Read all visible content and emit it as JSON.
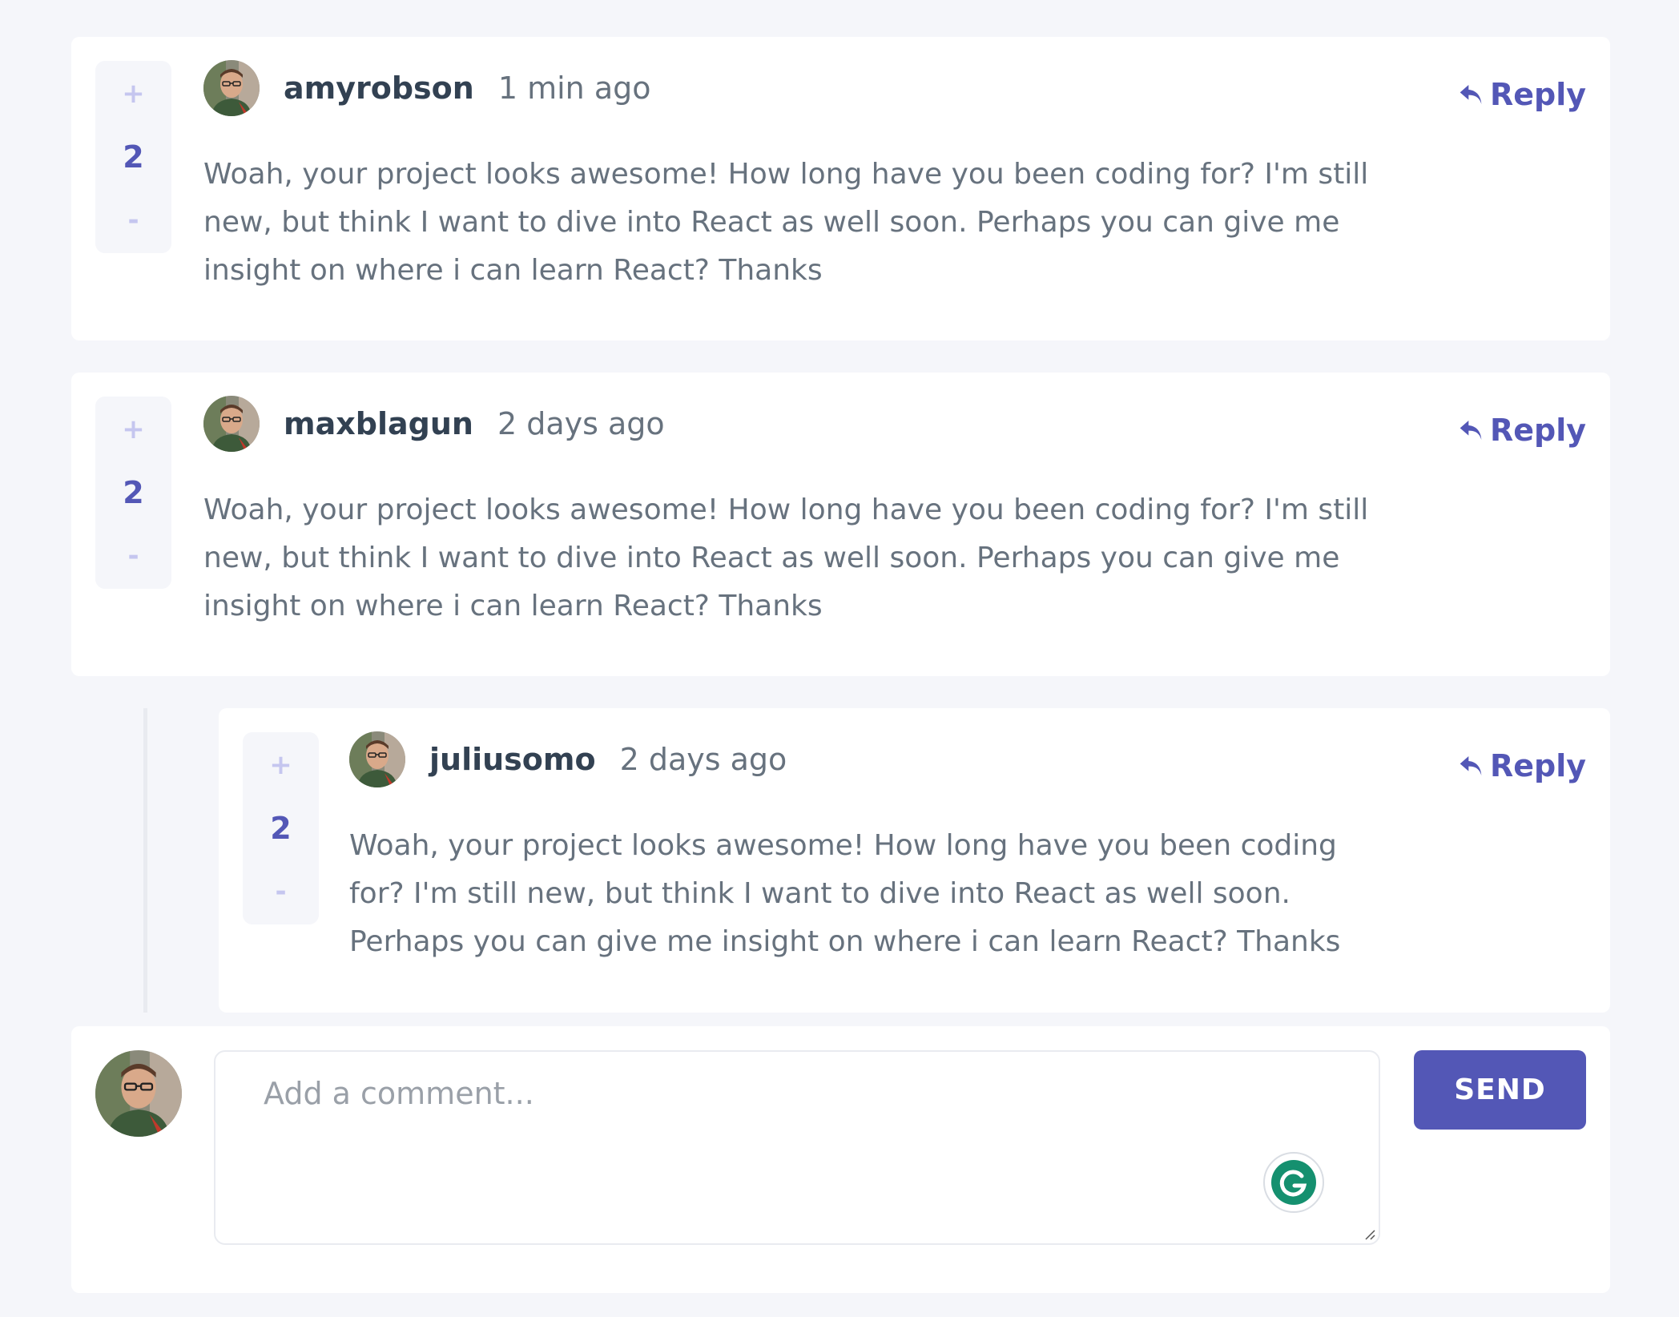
{
  "colors": {
    "background": "#f5f6fa",
    "card": "#ffffff",
    "accent": "#5357b6",
    "accent_light": "#c5c6ef",
    "text_dark": "#324152",
    "text_muted": "#67727e"
  },
  "comments": [
    {
      "username": "amyrobson",
      "time": "1 min ago",
      "score": "2",
      "upvote": "+",
      "downvote": "-",
      "reply_label": "Reply",
      "content": "Woah, your project looks awesome! How long have you been coding for? I'm still new, but think I want to dive into React as well soon. Perhaps you can give me insight on where i can learn React? Thanks",
      "avatar_icon": "user-avatar-icon"
    },
    {
      "username": "maxblagun",
      "time": "2 days ago",
      "score": "2",
      "upvote": "+",
      "downvote": "-",
      "reply_label": "Reply",
      "content": "Woah, your project looks awesome! How long have you been coding for? I'm still new, but think I want to dive into React as well soon. Perhaps you can give me insight on where i can learn React? Thanks",
      "avatar_icon": "user-avatar-icon"
    }
  ],
  "replies": [
    {
      "username": "juliusomo",
      "time": "2 days ago",
      "score": "2",
      "upvote": "+",
      "downvote": "-",
      "reply_label": "Reply",
      "content": "Woah, your project looks awesome! How long have you been coding for? I'm still new, but think I want to dive into React as well soon. Perhaps you can give me insight on where i can learn React? Thanks",
      "avatar_icon": "user-avatar-icon"
    }
  ],
  "composer": {
    "placeholder": "Add a comment...",
    "send_label": "SEND",
    "grammarly_icon": "grammarly-icon"
  }
}
